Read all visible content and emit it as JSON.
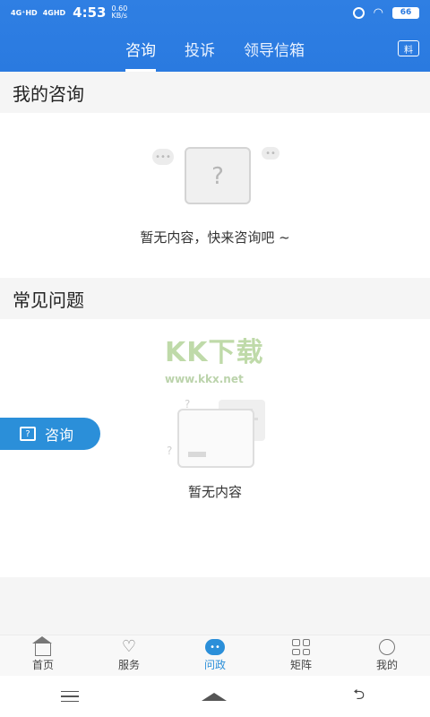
{
  "status_bar": {
    "signal1": "4G⁺HD",
    "signal2": "4GHD",
    "time": "4:53",
    "speed": "0.60\nKB/s",
    "battery": "66"
  },
  "tabs": [
    {
      "label": "咨询",
      "active": true
    },
    {
      "label": "投诉",
      "active": false
    },
    {
      "label": "领导信箱",
      "active": false
    }
  ],
  "tab_right_icon": "料",
  "my_consult": {
    "title": "我的咨询",
    "empty_text": "暂无内容，快来咨询吧 ~"
  },
  "faq": {
    "title": "常见问题",
    "empty_text": "暂无内容"
  },
  "watermark": {
    "logo": "KK下载",
    "url": "www.kkx.net"
  },
  "float_button": {
    "label": "咨询"
  },
  "bottom_nav": [
    {
      "label": "首页",
      "icon": "home-icon",
      "active": false
    },
    {
      "label": "服务",
      "icon": "heart-icon",
      "active": false
    },
    {
      "label": "问政",
      "icon": "chat-bubble-icon",
      "active": true
    },
    {
      "label": "矩阵",
      "icon": "grid-icon",
      "active": false
    },
    {
      "label": "我的",
      "icon": "profile-icon",
      "active": false
    }
  ],
  "colors": {
    "accent": "#2a7ae0",
    "button": "#2b8fd9"
  }
}
